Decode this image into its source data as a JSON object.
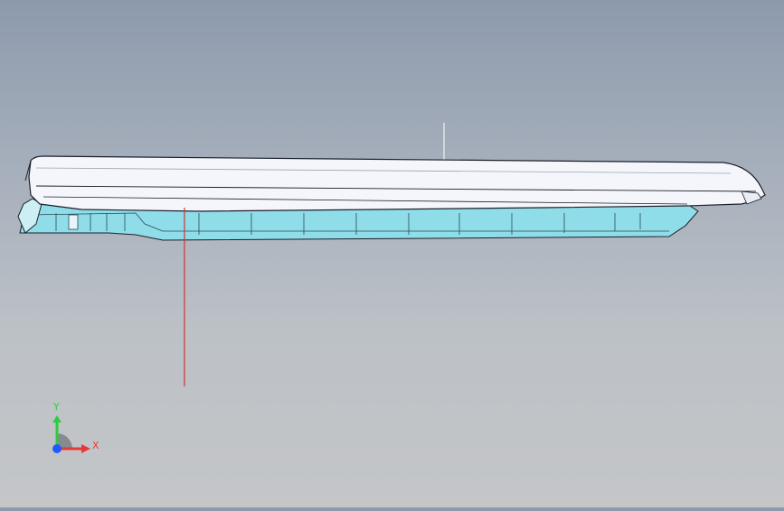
{
  "viewport": {
    "model_name": "",
    "colors": {
      "background_top": "#8d9aac",
      "background_bottom": "#c4c6c8",
      "top_shell": "#f4f6fb",
      "lower_body": "#8fdde8",
      "edge_line": "#1b1f2a",
      "section_line": "#d0333a",
      "reference_line": "#f2f2f2"
    }
  },
  "triad": {
    "x_label": "X",
    "y_label": "Y",
    "x_color": "#e53935",
    "y_color": "#2ecc40",
    "z_color": "#1e5bff"
  }
}
